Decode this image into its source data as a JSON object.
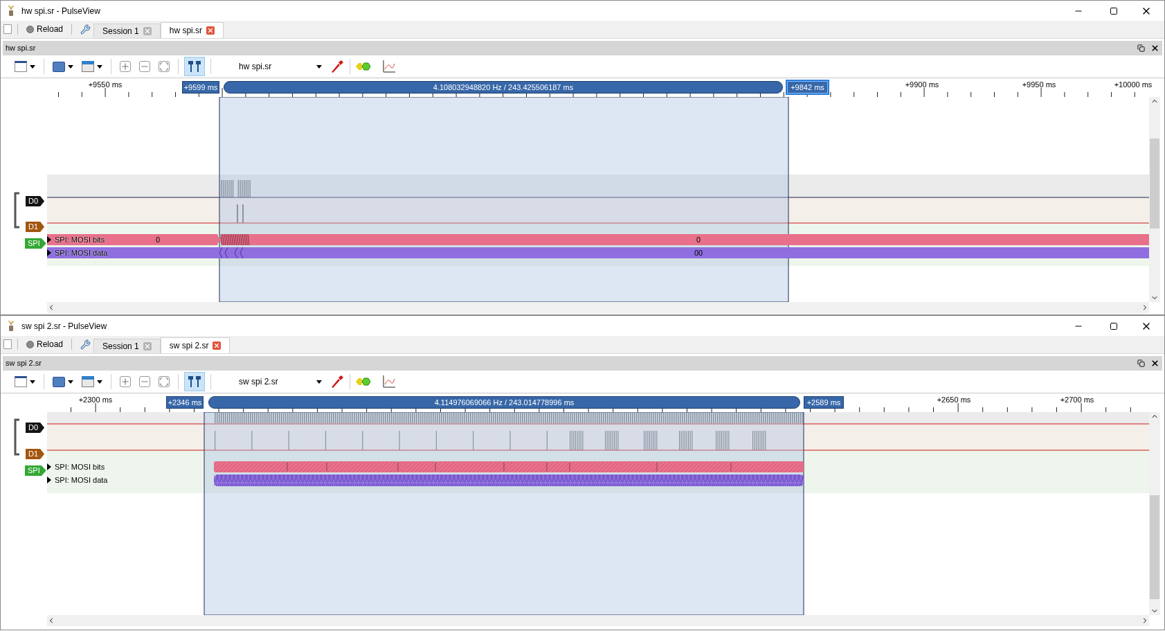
{
  "windows": [
    {
      "title": "hw spi.sr - PulseView",
      "reload": "Reload",
      "tabs": [
        {
          "label": "Session 1",
          "selected": false
        },
        {
          "label": "hw spi.sr",
          "selected": true
        }
      ],
      "panel_title": "hw spi.sr",
      "toolbar": {
        "show_cursors": true,
        "device": "hw spi.sr"
      },
      "ruler_labels": [
        "+9550 ms",
        "+9900 ms",
        "+9950 ms",
        "+10000 ms"
      ],
      "cursors": {
        "markers": [
          {
            "label": "+9599 ms",
            "selected": false
          },
          {
            "label": "+9842 ms",
            "selected": true
          }
        ],
        "measurement": "4.108032948820 Hz / 243.425506187 ms"
      },
      "channels": [
        {
          "name": "D0",
          "color": "#141414"
        },
        {
          "name": "D1",
          "color": "#a3560f"
        }
      ],
      "decoder": {
        "name": "SPI",
        "color": "#34a834",
        "rows": [
          {
            "label": "SPI: MOSI bits",
            "color": "#e8708a",
            "values": [
              "0",
              "0"
            ]
          },
          {
            "label": "SPI: MOSI data",
            "color": "#8f6ee0",
            "values": [
              "00"
            ]
          }
        ]
      }
    },
    {
      "title": "sw spi 2.sr - PulseView",
      "reload": "Reload",
      "tabs": [
        {
          "label": "Session 1",
          "selected": false
        },
        {
          "label": "sw spi 2.sr",
          "selected": true
        }
      ],
      "panel_title": "sw spi 2.sr",
      "toolbar": {
        "show_cursors": true,
        "device": "sw spi 2.sr"
      },
      "ruler_labels": [
        "+2300 ms",
        "+2650 ms",
        "+2700 ms"
      ],
      "cursors": {
        "markers": [
          {
            "label": "+2346 ms",
            "selected": false
          },
          {
            "label": "+2589 ms",
            "selected": false
          }
        ],
        "measurement": "4.114976069066 Hz / 243.014778996 ms"
      },
      "channels": [
        {
          "name": "D0",
          "color": "#141414"
        },
        {
          "name": "D1",
          "color": "#a3560f"
        }
      ],
      "decoder": {
        "name": "SPI",
        "color": "#34a834",
        "rows": [
          {
            "label": "SPI: MOSI bits",
            "color": "#e8708a",
            "values": []
          },
          {
            "label": "SPI: MOSI data",
            "color": "#8f6ee0",
            "values": []
          }
        ]
      }
    }
  ]
}
